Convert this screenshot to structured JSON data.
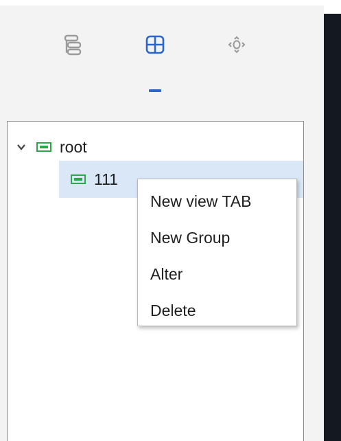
{
  "toolbar": {
    "icons": [
      {
        "name": "layers-icon"
      },
      {
        "name": "grid-icon",
        "active": true
      },
      {
        "name": "target-icon"
      }
    ]
  },
  "tree": {
    "root": {
      "label": "root",
      "expanded": true
    },
    "children": [
      {
        "label": "111",
        "selected": true
      }
    ]
  },
  "context_menu": {
    "items": [
      "New view TAB",
      "New Group",
      "Alter",
      "Delete"
    ]
  },
  "colors": {
    "accent": "#2b66c9",
    "node_icon": "#2ea64a",
    "selection": "#d9e7f7",
    "dark_panel": "#141821"
  }
}
